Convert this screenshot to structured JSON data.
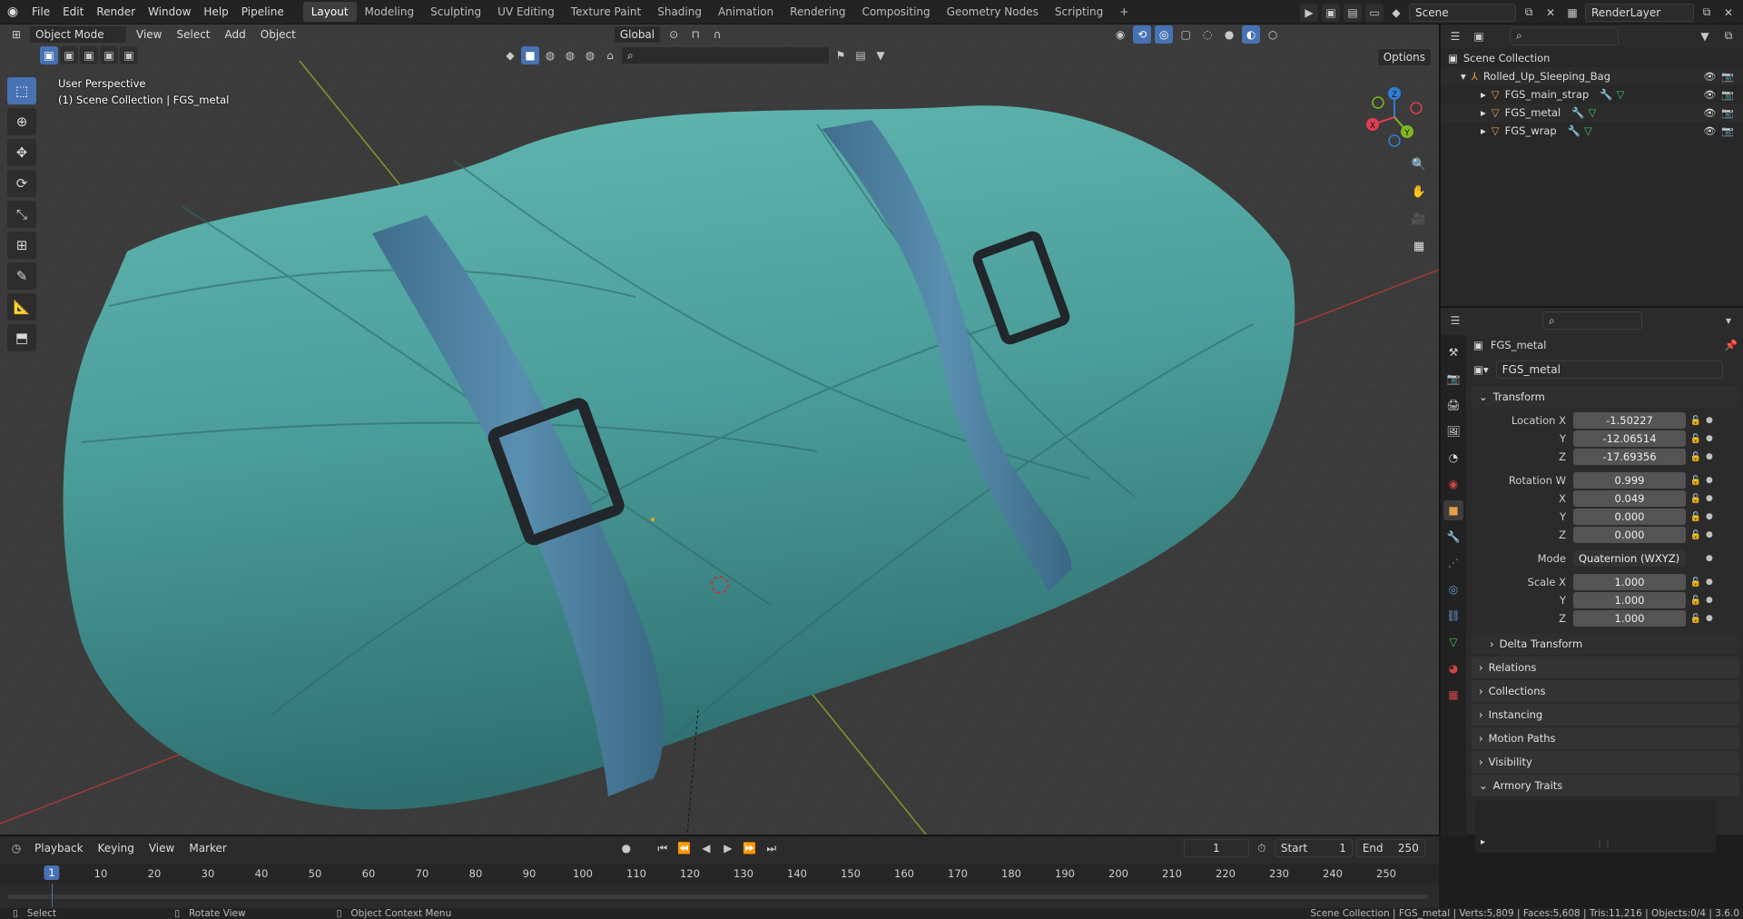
{
  "topbar": {
    "menus": [
      "File",
      "Edit",
      "Render",
      "Window",
      "Help",
      "Pipeline"
    ],
    "workspaces": [
      "Layout",
      "Modeling",
      "Sculpting",
      "UV Editing",
      "Texture Paint",
      "Shading",
      "Animation",
      "Rendering",
      "Compositing",
      "Geometry Nodes",
      "Scripting"
    ],
    "active_workspace": "Layout",
    "scene": "Scene",
    "view_layer": "RenderLayer"
  },
  "viewport": {
    "mode": "Object Mode",
    "menus": [
      "View",
      "Select",
      "Add",
      "Object"
    ],
    "orientation": "Global",
    "options": "Options",
    "info_line1": "User Perspective",
    "info_line2": "(1) Scene Collection | FGS_metal",
    "gizmo": {
      "z": "Z",
      "y": "Y",
      "x": "X"
    }
  },
  "outliner": {
    "root": "Scene Collection",
    "items": [
      {
        "name": "Rolled_Up_Sleeping_Bag",
        "type": "armature"
      },
      {
        "name": "FGS_main_strap",
        "type": "mesh"
      },
      {
        "name": "FGS_metal",
        "type": "mesh"
      },
      {
        "name": "FGS_wrap",
        "type": "mesh"
      }
    ]
  },
  "properties": {
    "object_name": "FGS_metal",
    "datablock": "FGS_metal",
    "transform_title": "Transform",
    "location": {
      "label": "Location X",
      "x": "-1.50227",
      "y": "-12.06514",
      "z": "-17.69356"
    },
    "rotation": {
      "label": "Rotation W",
      "w": "0.999",
      "x": "0.049",
      "y": "0.000",
      "z": "0.000"
    },
    "mode_label": "Mode",
    "mode_value": "Quaternion (WXYZ)",
    "scale": {
      "label": "Scale X",
      "x": "1.000",
      "y": "1.000",
      "z": "1.000"
    },
    "axis_y": "Y",
    "axis_z": "Z",
    "axis_x": "X",
    "delta": "Delta Transform",
    "panels": [
      "Relations",
      "Collections",
      "Instancing",
      "Motion Paths",
      "Visibility",
      "Armory Traits"
    ]
  },
  "timeline": {
    "menus": [
      "Playback",
      "Keying",
      "View",
      "Marker"
    ],
    "current_frame": "1",
    "start_label": "Start",
    "start": "1",
    "end_label": "End",
    "end": "250",
    "ticks": [
      "10",
      "20",
      "30",
      "40",
      "50",
      "60",
      "70",
      "80",
      "90",
      "100",
      "110",
      "120",
      "130",
      "140",
      "150",
      "160",
      "170",
      "180",
      "190",
      "200",
      "210",
      "220",
      "230",
      "240",
      "250"
    ]
  },
  "statusbar": {
    "select": "Select",
    "rotate": "Rotate View",
    "context": "Object Context Menu",
    "info": "Scene Collection | FGS_metal | Verts:5,809 | Faces:5,608 | Tris:11,216 | Objects:0/4 | 3.6.0"
  },
  "colors": {
    "accent": "#4772b3",
    "bag": "#4fa3a0",
    "strap": "#4a7e9c",
    "metal": "#2b2f33"
  }
}
